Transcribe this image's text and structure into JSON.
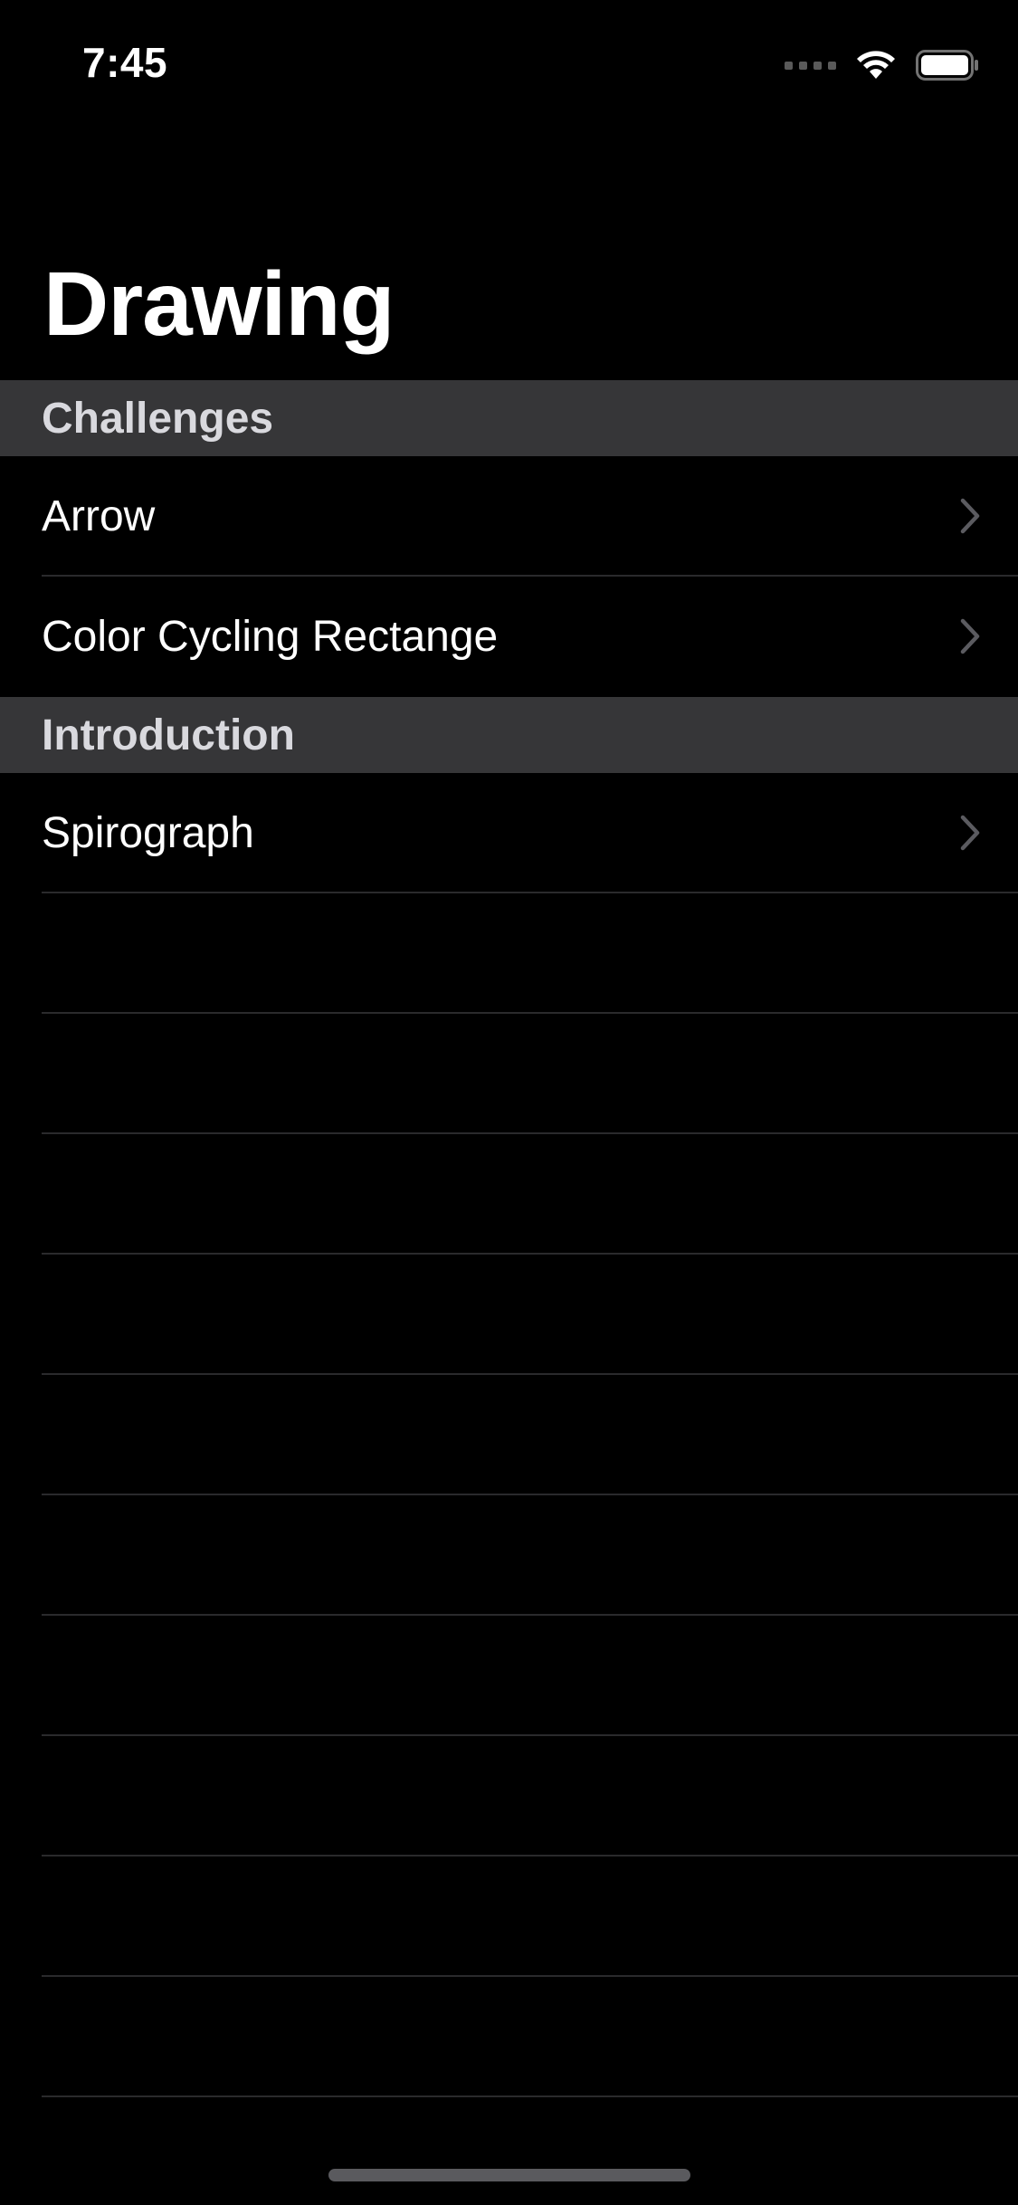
{
  "status_bar": {
    "time": "7:45",
    "signal_icon": "cellular-signal-icon",
    "wifi_icon": "wifi-icon",
    "battery_icon": "battery-icon"
  },
  "nav": {
    "title": "Drawing"
  },
  "sections": [
    {
      "header": "Challenges",
      "rows": [
        {
          "label": "Arrow",
          "icon": "chevron-right-icon"
        },
        {
          "label": "Color Cycling Rectange",
          "icon": "chevron-right-icon"
        }
      ]
    },
    {
      "header": "Introduction",
      "rows": [
        {
          "label": "Spirograph",
          "icon": "chevron-right-icon"
        }
      ]
    }
  ],
  "colors": {
    "background": "#000000",
    "section_header_bg": "#363638",
    "section_header_text": "#d9d9de",
    "row_text": "#ffffff",
    "separator": "#2a2a2c",
    "chevron": "#5b5b60"
  }
}
